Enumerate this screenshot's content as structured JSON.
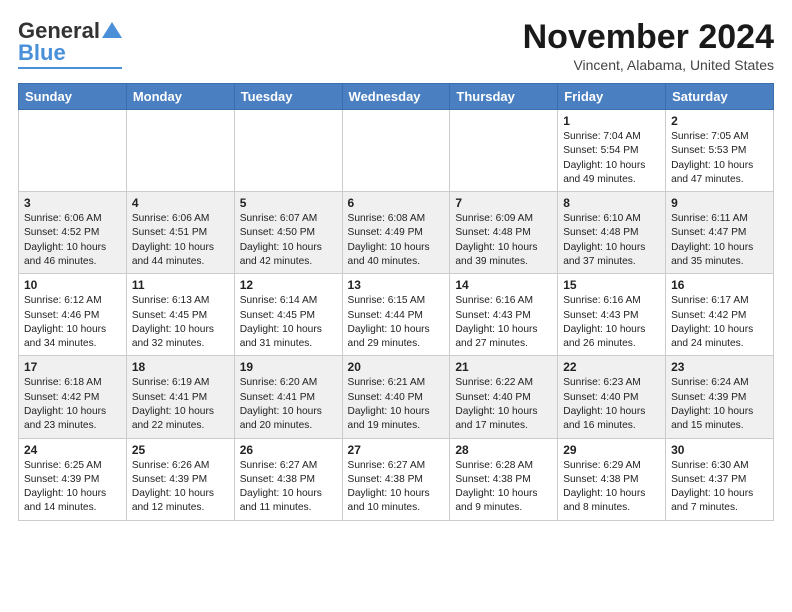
{
  "logo": {
    "general": "General",
    "blue": "Blue"
  },
  "header": {
    "month_title": "November 2024",
    "location": "Vincent, Alabama, United States"
  },
  "weekdays": [
    "Sunday",
    "Monday",
    "Tuesday",
    "Wednesday",
    "Thursday",
    "Friday",
    "Saturday"
  ],
  "weeks": [
    [
      {
        "day": "",
        "info": ""
      },
      {
        "day": "",
        "info": ""
      },
      {
        "day": "",
        "info": ""
      },
      {
        "day": "",
        "info": ""
      },
      {
        "day": "",
        "info": ""
      },
      {
        "day": "1",
        "info": "Sunrise: 7:04 AM\nSunset: 5:54 PM\nDaylight: 10 hours\nand 49 minutes."
      },
      {
        "day": "2",
        "info": "Sunrise: 7:05 AM\nSunset: 5:53 PM\nDaylight: 10 hours\nand 47 minutes."
      }
    ],
    [
      {
        "day": "3",
        "info": "Sunrise: 6:06 AM\nSunset: 4:52 PM\nDaylight: 10 hours\nand 46 minutes."
      },
      {
        "day": "4",
        "info": "Sunrise: 6:06 AM\nSunset: 4:51 PM\nDaylight: 10 hours\nand 44 minutes."
      },
      {
        "day": "5",
        "info": "Sunrise: 6:07 AM\nSunset: 4:50 PM\nDaylight: 10 hours\nand 42 minutes."
      },
      {
        "day": "6",
        "info": "Sunrise: 6:08 AM\nSunset: 4:49 PM\nDaylight: 10 hours\nand 40 minutes."
      },
      {
        "day": "7",
        "info": "Sunrise: 6:09 AM\nSunset: 4:48 PM\nDaylight: 10 hours\nand 39 minutes."
      },
      {
        "day": "8",
        "info": "Sunrise: 6:10 AM\nSunset: 4:48 PM\nDaylight: 10 hours\nand 37 minutes."
      },
      {
        "day": "9",
        "info": "Sunrise: 6:11 AM\nSunset: 4:47 PM\nDaylight: 10 hours\nand 35 minutes."
      }
    ],
    [
      {
        "day": "10",
        "info": "Sunrise: 6:12 AM\nSunset: 4:46 PM\nDaylight: 10 hours\nand 34 minutes."
      },
      {
        "day": "11",
        "info": "Sunrise: 6:13 AM\nSunset: 4:45 PM\nDaylight: 10 hours\nand 32 minutes."
      },
      {
        "day": "12",
        "info": "Sunrise: 6:14 AM\nSunset: 4:45 PM\nDaylight: 10 hours\nand 31 minutes."
      },
      {
        "day": "13",
        "info": "Sunrise: 6:15 AM\nSunset: 4:44 PM\nDaylight: 10 hours\nand 29 minutes."
      },
      {
        "day": "14",
        "info": "Sunrise: 6:16 AM\nSunset: 4:43 PM\nDaylight: 10 hours\nand 27 minutes."
      },
      {
        "day": "15",
        "info": "Sunrise: 6:16 AM\nSunset: 4:43 PM\nDaylight: 10 hours\nand 26 minutes."
      },
      {
        "day": "16",
        "info": "Sunrise: 6:17 AM\nSunset: 4:42 PM\nDaylight: 10 hours\nand 24 minutes."
      }
    ],
    [
      {
        "day": "17",
        "info": "Sunrise: 6:18 AM\nSunset: 4:42 PM\nDaylight: 10 hours\nand 23 minutes."
      },
      {
        "day": "18",
        "info": "Sunrise: 6:19 AM\nSunset: 4:41 PM\nDaylight: 10 hours\nand 22 minutes."
      },
      {
        "day": "19",
        "info": "Sunrise: 6:20 AM\nSunset: 4:41 PM\nDaylight: 10 hours\nand 20 minutes."
      },
      {
        "day": "20",
        "info": "Sunrise: 6:21 AM\nSunset: 4:40 PM\nDaylight: 10 hours\nand 19 minutes."
      },
      {
        "day": "21",
        "info": "Sunrise: 6:22 AM\nSunset: 4:40 PM\nDaylight: 10 hours\nand 17 minutes."
      },
      {
        "day": "22",
        "info": "Sunrise: 6:23 AM\nSunset: 4:40 PM\nDaylight: 10 hours\nand 16 minutes."
      },
      {
        "day": "23",
        "info": "Sunrise: 6:24 AM\nSunset: 4:39 PM\nDaylight: 10 hours\nand 15 minutes."
      }
    ],
    [
      {
        "day": "24",
        "info": "Sunrise: 6:25 AM\nSunset: 4:39 PM\nDaylight: 10 hours\nand 14 minutes."
      },
      {
        "day": "25",
        "info": "Sunrise: 6:26 AM\nSunset: 4:39 PM\nDaylight: 10 hours\nand 12 minutes."
      },
      {
        "day": "26",
        "info": "Sunrise: 6:27 AM\nSunset: 4:38 PM\nDaylight: 10 hours\nand 11 minutes."
      },
      {
        "day": "27",
        "info": "Sunrise: 6:27 AM\nSunset: 4:38 PM\nDaylight: 10 hours\nand 10 minutes."
      },
      {
        "day": "28",
        "info": "Sunrise: 6:28 AM\nSunset: 4:38 PM\nDaylight: 10 hours\nand 9 minutes."
      },
      {
        "day": "29",
        "info": "Sunrise: 6:29 AM\nSunset: 4:38 PM\nDaylight: 10 hours\nand 8 minutes."
      },
      {
        "day": "30",
        "info": "Sunrise: 6:30 AM\nSunset: 4:37 PM\nDaylight: 10 hours\nand 7 minutes."
      }
    ]
  ]
}
